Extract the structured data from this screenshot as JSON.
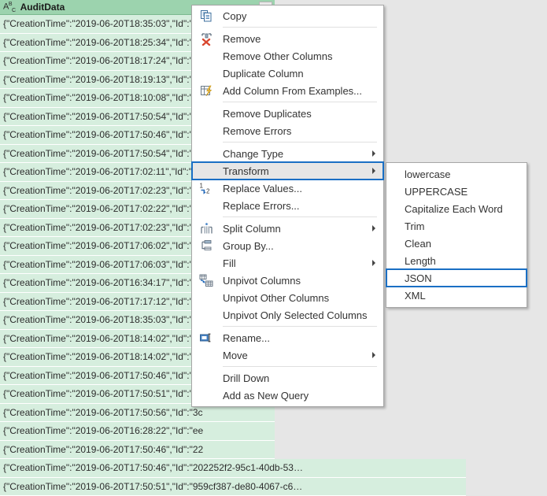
{
  "grid": {
    "column": {
      "type_icon": "abc-text-type-icon",
      "type_icon_text": "ABC",
      "name": "AuditData",
      "filter_icon": "filter-dropdown-icon"
    },
    "rows": [
      {
        "text": "{\"CreationTime\":\"2019-06-20T18:35:03\",\"Id\":\"1c",
        "wide": false
      },
      {
        "text": "{\"CreationTime\":\"2019-06-20T18:25:34\",\"Id\":\"d0",
        "wide": false
      },
      {
        "text": "{\"CreationTime\":\"2019-06-20T18:17:24\",\"Id\":\"30",
        "wide": false
      },
      {
        "text": "{\"CreationTime\":\"2019-06-20T18:19:13\",\"Id\":\"be",
        "wide": false
      },
      {
        "text": "{\"CreationTime\":\"2019-06-20T18:10:08\",\"Id\":\"a5",
        "wide": false
      },
      {
        "text": "{\"CreationTime\":\"2019-06-20T17:50:54\",\"Id\":\"97",
        "wide": false
      },
      {
        "text": "{\"CreationTime\":\"2019-06-20T17:50:46\",\"Id\":\"1f8",
        "wide": false
      },
      {
        "text": "{\"CreationTime\":\"2019-06-20T17:50:54\",\"Id\":\"97",
        "wide": false
      },
      {
        "text": "{\"CreationTime\":\"2019-06-20T17:02:11\",\"Id\":\"ed",
        "wide": false
      },
      {
        "text": "{\"CreationTime\":\"2019-06-20T17:02:23\",\"Id\":\"4a",
        "wide": false
      },
      {
        "text": "{\"CreationTime\":\"2019-06-20T17:02:22\",\"Id\":\"b3",
        "wide": false
      },
      {
        "text": "{\"CreationTime\":\"2019-06-20T17:02:23\",\"Id\":\"cd",
        "wide": false
      },
      {
        "text": "{\"CreationTime\":\"2019-06-20T17:06:02\",\"Id\":\"69",
        "wide": false
      },
      {
        "text": "{\"CreationTime\":\"2019-06-20T17:06:03\",\"Id\":\"fda",
        "wide": false
      },
      {
        "text": "{\"CreationTime\":\"2019-06-20T16:34:17\",\"Id\":\"1d",
        "wide": false
      },
      {
        "text": "{\"CreationTime\":\"2019-06-20T17:17:12\",\"Id\":\"fef",
        "wide": false
      },
      {
        "text": "{\"CreationTime\":\"2019-06-20T18:35:03\",\"Id\":\"1c",
        "wide": false
      },
      {
        "text": "{\"CreationTime\":\"2019-06-20T18:14:02\",\"Id\":\"20",
        "wide": false
      },
      {
        "text": "{\"CreationTime\":\"2019-06-20T18:14:02\",\"Id\":\"20",
        "wide": false
      },
      {
        "text": "{\"CreationTime\":\"2019-06-20T17:50:46\",\"Id\":\"20",
        "wide": false
      },
      {
        "text": "{\"CreationTime\":\"2019-06-20T17:50:51\",\"Id\":\"95",
        "wide": false
      },
      {
        "text": "{\"CreationTime\":\"2019-06-20T17:50:56\",\"Id\":\"3c",
        "wide": false
      },
      {
        "text": "{\"CreationTime\":\"2019-06-20T16:28:22\",\"Id\":\"ee",
        "wide": false
      },
      {
        "text": "{\"CreationTime\":\"2019-06-20T17:50:46\",\"Id\":\"22",
        "wide": false
      },
      {
        "text": "{\"CreationTime\":\"2019-06-20T17:50:46\",\"Id\":\"202252f2-95c1-40db-53…",
        "wide": true
      },
      {
        "text": "{\"CreationTime\":\"2019-06-20T17:50:51\",\"Id\":\"959cf387-de80-4067-c6…",
        "wide": true
      }
    ]
  },
  "context_menu": {
    "items": [
      {
        "label": "Copy",
        "icon": "copy-icon",
        "submenu": false,
        "highlight": false,
        "sep_after": true
      },
      {
        "label": "Remove",
        "icon": "remove-column-icon",
        "submenu": false,
        "highlight": false,
        "sep_after": false
      },
      {
        "label": "Remove Other Columns",
        "icon": "",
        "submenu": false,
        "highlight": false,
        "sep_after": false
      },
      {
        "label": "Duplicate Column",
        "icon": "",
        "submenu": false,
        "highlight": false,
        "sep_after": false
      },
      {
        "label": "Add Column From Examples...",
        "icon": "add-column-examples-icon",
        "submenu": false,
        "highlight": false,
        "sep_after": true
      },
      {
        "label": "Remove Duplicates",
        "icon": "",
        "submenu": false,
        "highlight": false,
        "sep_after": false
      },
      {
        "label": "Remove Errors",
        "icon": "",
        "submenu": false,
        "highlight": false,
        "sep_after": true
      },
      {
        "label": "Change Type",
        "icon": "",
        "submenu": true,
        "highlight": false,
        "sep_after": false
      },
      {
        "label": "Transform",
        "icon": "",
        "submenu": true,
        "highlight": true,
        "sep_after": false
      },
      {
        "label": "Replace Values...",
        "icon": "replace-values-icon",
        "submenu": false,
        "highlight": false,
        "sep_after": false
      },
      {
        "label": "Replace Errors...",
        "icon": "",
        "submenu": false,
        "highlight": false,
        "sep_after": true
      },
      {
        "label": "Split Column",
        "icon": "split-column-icon",
        "submenu": true,
        "highlight": false,
        "sep_after": false
      },
      {
        "label": "Group By...",
        "icon": "group-by-icon",
        "submenu": false,
        "highlight": false,
        "sep_after": false
      },
      {
        "label": "Fill",
        "icon": "",
        "submenu": true,
        "highlight": false,
        "sep_after": false
      },
      {
        "label": "Unpivot Columns",
        "icon": "unpivot-columns-icon",
        "submenu": false,
        "highlight": false,
        "sep_after": false
      },
      {
        "label": "Unpivot Other Columns",
        "icon": "",
        "submenu": false,
        "highlight": false,
        "sep_after": false
      },
      {
        "label": "Unpivot Only Selected Columns",
        "icon": "",
        "submenu": false,
        "highlight": false,
        "sep_after": true
      },
      {
        "label": "Rename...",
        "icon": "rename-icon",
        "submenu": false,
        "highlight": false,
        "sep_after": false
      },
      {
        "label": "Move",
        "icon": "",
        "submenu": true,
        "highlight": false,
        "sep_after": true
      },
      {
        "label": "Drill Down",
        "icon": "",
        "submenu": false,
        "highlight": false,
        "sep_after": false
      },
      {
        "label": "Add as New Query",
        "icon": "",
        "submenu": false,
        "highlight": false,
        "sep_after": false
      }
    ]
  },
  "submenu": {
    "items": [
      {
        "label": "lowercase",
        "highlight": false
      },
      {
        "label": "UPPERCASE",
        "highlight": false
      },
      {
        "label": "Capitalize Each Word",
        "highlight": false
      },
      {
        "label": "Trim",
        "highlight": false
      },
      {
        "label": "Clean",
        "highlight": false
      },
      {
        "label": "Length",
        "highlight": false
      },
      {
        "label": "JSON",
        "highlight": true
      },
      {
        "label": "XML",
        "highlight": false
      }
    ]
  },
  "colors": {
    "header_green": "#9cd3ae",
    "row_green": "#d6eede",
    "highlight_blue": "#1a6fc4",
    "app_background": "#e6e6e6"
  }
}
